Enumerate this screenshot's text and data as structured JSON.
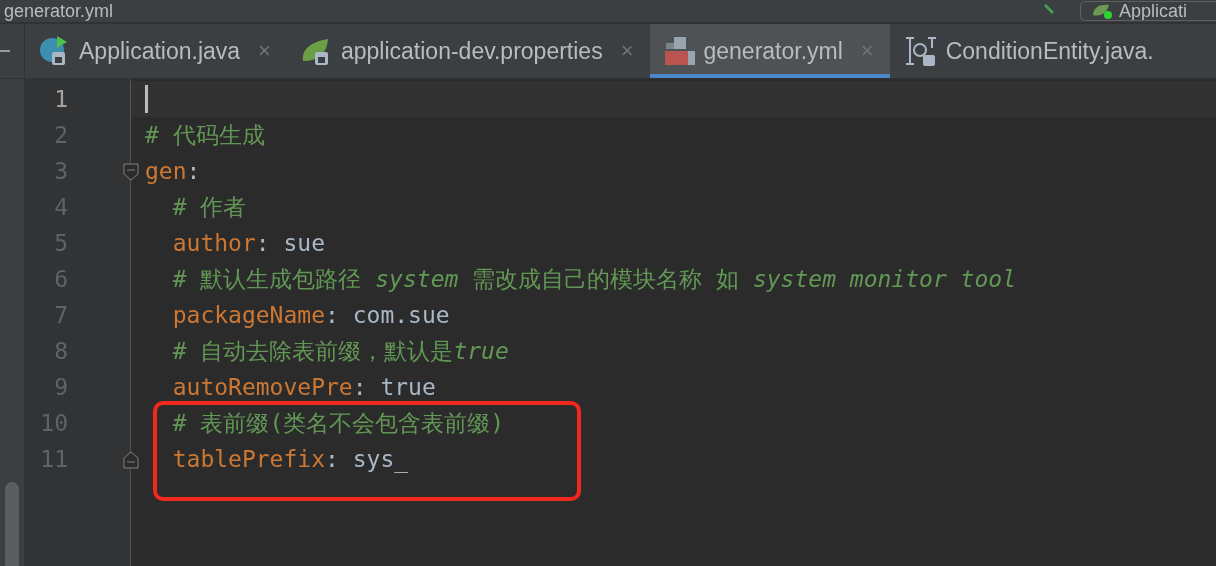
{
  "window": {
    "title": "generator.yml"
  },
  "run_config": {
    "label": "Applicati"
  },
  "tabs": [
    {
      "label": "Application.java",
      "kind": "java",
      "selected": false,
      "close": "×"
    },
    {
      "label": "application-dev.properties",
      "kind": "spring",
      "selected": false,
      "close": "×"
    },
    {
      "label": "generator.yml",
      "kind": "yaml",
      "selected": true,
      "close": "×"
    },
    {
      "label": "ConditionEntity.java.",
      "kind": "entity",
      "selected": false
    }
  ],
  "editor": {
    "lines": [
      {
        "number": "1",
        "current": true,
        "fold_start": false,
        "fold_end": false,
        "highlighted": false
      },
      {
        "number": "2",
        "current": false,
        "fold_start": false,
        "fold_end": false,
        "highlighted": false,
        "segments": [
          {
            "kind": "comment",
            "parts": [
              {
                "text": "# 代码生成",
                "italic": false
              }
            ]
          }
        ]
      },
      {
        "number": "3",
        "current": false,
        "fold_start": true,
        "fold_end": false,
        "highlighted": false,
        "segments": [
          {
            "kind": "key",
            "text": "gen"
          },
          {
            "kind": "punct",
            "text": ":"
          }
        ]
      },
      {
        "number": "4",
        "current": false,
        "fold_start": false,
        "fold_end": false,
        "highlighted": false,
        "segments": [
          {
            "kind": "comment",
            "parts": [
              {
                "text": "  # 作者",
                "italic": false
              }
            ]
          }
        ]
      },
      {
        "number": "5",
        "current": false,
        "fold_start": false,
        "fold_end": false,
        "highlighted": false,
        "segments": [
          {
            "kind": "key",
            "text": "  author"
          },
          {
            "kind": "punct",
            "text": ": "
          },
          {
            "kind": "value",
            "text": "sue"
          }
        ]
      },
      {
        "number": "6",
        "current": false,
        "fold_start": false,
        "fold_end": false,
        "highlighted": false,
        "segments": [
          {
            "kind": "comment",
            "parts": [
              {
                "text": "  # 默认生成包路径 ",
                "italic": false
              },
              {
                "text": "system",
                "italic": true
              },
              {
                "text": " 需改成自己的模块名称 如 ",
                "italic": false
              },
              {
                "text": "system monitor tool",
                "italic": true
              }
            ]
          }
        ]
      },
      {
        "number": "7",
        "current": false,
        "fold_start": false,
        "fold_end": false,
        "highlighted": false,
        "segments": [
          {
            "kind": "key",
            "text": "  packageName"
          },
          {
            "kind": "punct",
            "text": ": "
          },
          {
            "kind": "value",
            "text": "com.sue"
          }
        ]
      },
      {
        "number": "8",
        "current": false,
        "fold_start": false,
        "fold_end": false,
        "highlighted": false,
        "segments": [
          {
            "kind": "comment",
            "parts": [
              {
                "text": "  # 自动去除表前缀，默认是",
                "italic": false
              },
              {
                "text": "true",
                "italic": true
              }
            ]
          }
        ]
      },
      {
        "number": "9",
        "current": false,
        "fold_start": false,
        "fold_end": false,
        "highlighted": false,
        "segments": [
          {
            "kind": "key",
            "text": "  autoRemovePre"
          },
          {
            "kind": "punct",
            "text": ": "
          },
          {
            "kind": "value",
            "text": "true"
          }
        ]
      },
      {
        "number": "10",
        "current": false,
        "fold_start": false,
        "fold_end": false,
        "highlighted": true,
        "segments": [
          {
            "kind": "comment",
            "parts": [
              {
                "text": "  # 表前缀(类名不会包含表前缀)",
                "italic": false
              }
            ]
          }
        ]
      },
      {
        "number": "11",
        "current": false,
        "fold_start": false,
        "fold_end": true,
        "highlighted": true,
        "segments": [
          {
            "kind": "key",
            "text": "  tablePrefix"
          },
          {
            "kind": "punct",
            "text": ": "
          },
          {
            "kind": "value",
            "text": "sys_"
          }
        ]
      }
    ]
  }
}
